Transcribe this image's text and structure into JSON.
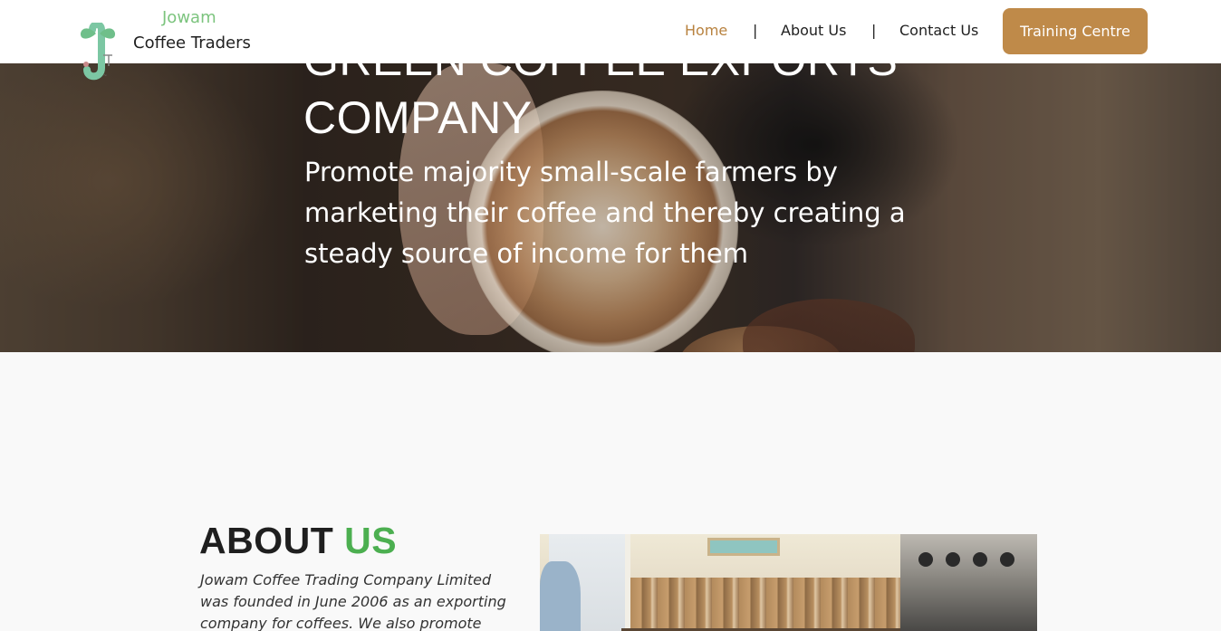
{
  "header": {
    "brand_top": "Jowam",
    "brand_bottom": "Coffee Traders",
    "nav": [
      {
        "label": "Home",
        "active": true
      },
      {
        "label": "About Us",
        "active": false
      },
      {
        "label": "Contact Us",
        "active": false
      }
    ],
    "separator": "|",
    "cta_label": "Training Centre"
  },
  "hero": {
    "title_line1": "GREEN COFFEE EXPORTS",
    "title_line2": "COMPANY",
    "subtitle": "Promote majority small-scale farmers by marketing their coffee and thereby creating a steady source of income for them"
  },
  "about": {
    "heading_main": "ABOUT",
    "heading_accent": "US",
    "text": "Jowam Coffee Trading Company Limited was founded in June 2006 as an exporting company for coffees. We also promote"
  },
  "colors": {
    "accent_brown": "#bf8a49",
    "active_nav": "#b8823f",
    "brand_green": "#7cc47e",
    "heading_green": "#4caf50"
  }
}
